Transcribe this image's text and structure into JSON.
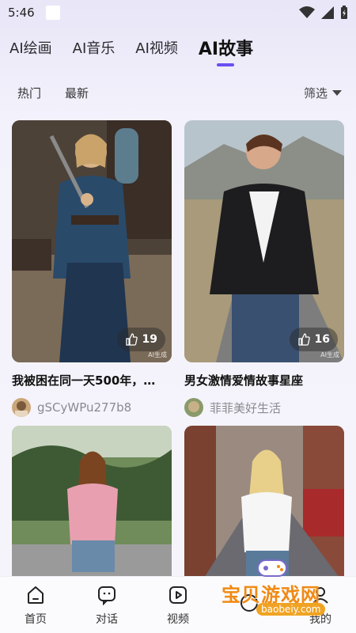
{
  "status": {
    "time": "5:46"
  },
  "top_tabs": [
    {
      "label": "AI绘画",
      "active": false
    },
    {
      "label": "AI音乐",
      "active": false
    },
    {
      "label": "AI视频",
      "active": false
    },
    {
      "label": "AI故事",
      "active": true
    }
  ],
  "filters": {
    "hot": "热门",
    "latest": "最新",
    "filter": "筛选"
  },
  "cards": [
    {
      "title": "我被困在同一天500年，…",
      "author": "gSCyWPu277b8",
      "likes": "19",
      "watermark": "AI生成"
    },
    {
      "title": "男女激情爱情故事星座",
      "author": "菲菲美好生活",
      "likes": "16",
      "watermark": "AI生成"
    },
    {
      "title": "",
      "author": "",
      "likes": ""
    },
    {
      "title": "",
      "author": "",
      "likes": ""
    }
  ],
  "bottom_nav": [
    {
      "label": "首页",
      "icon": "home-icon"
    },
    {
      "label": "对话",
      "icon": "chat-icon"
    },
    {
      "label": "视频",
      "icon": "video-icon"
    },
    {
      "label": "",
      "icon": "create-icon"
    },
    {
      "label": "我的",
      "icon": "profile-icon"
    }
  ],
  "watermark_brand": {
    "text": "宝贝游戏网",
    "url": "baobeiy.com"
  },
  "colors": {
    "accent": "#6a4ef0",
    "brand_orange": "#f08a14"
  }
}
